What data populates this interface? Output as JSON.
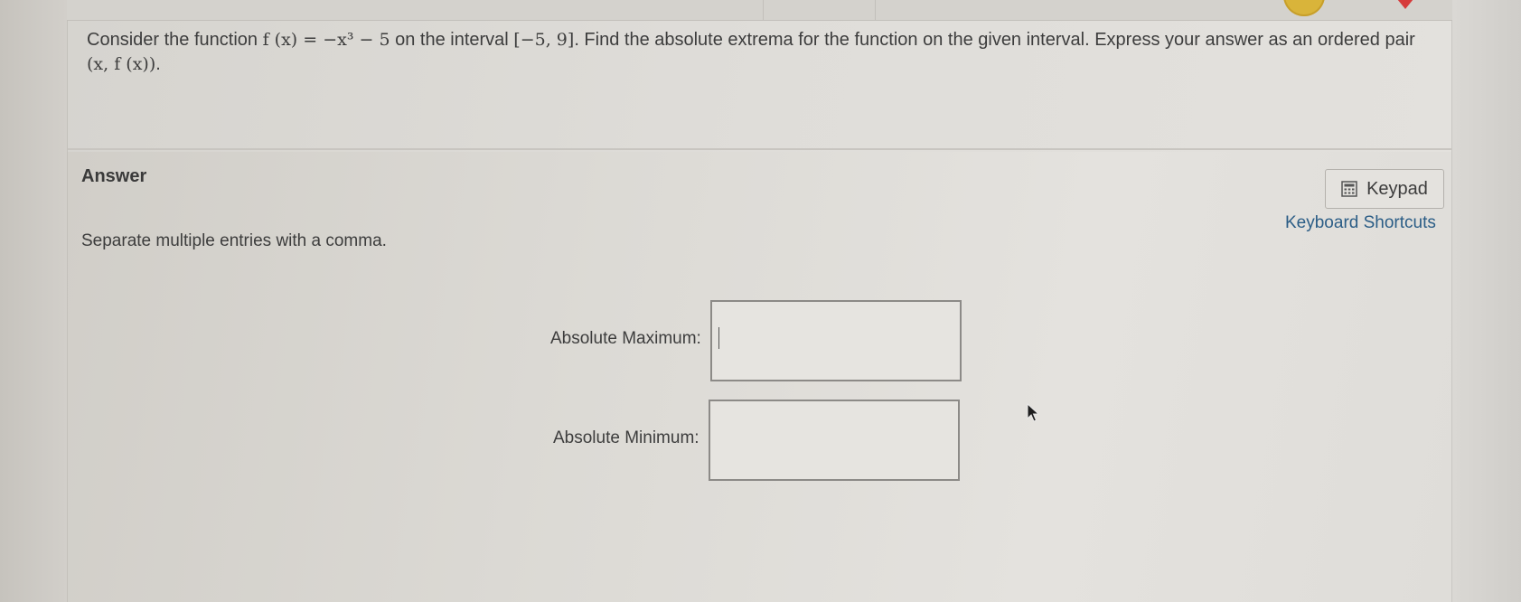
{
  "question": {
    "lead": "Consider the function",
    "function_expr": "f (x) = −x³ − 5",
    "mid": "on the interval",
    "interval": "[−5, 9]",
    "tail": ". Find the absolute extrema for the function on the given interval. Express your answer as an ordered pair",
    "pair": "(x, f (x))",
    "end": "."
  },
  "answer": {
    "label": "Answer",
    "instructions": "Separate multiple entries with a comma.",
    "keypad_label": "Keypad",
    "shortcuts_label": "Keyboard Shortcuts",
    "max_label": "Absolute Maximum:",
    "min_label": "Absolute Minimum:",
    "max_value": "",
    "min_value": ""
  },
  "colors": {
    "link": "#2b5d86",
    "badge_yellow": "#d9b43a",
    "badge_red": "#d63b3b"
  },
  "icons": [
    "keypad-icon",
    "mouse-cursor-icon"
  ]
}
